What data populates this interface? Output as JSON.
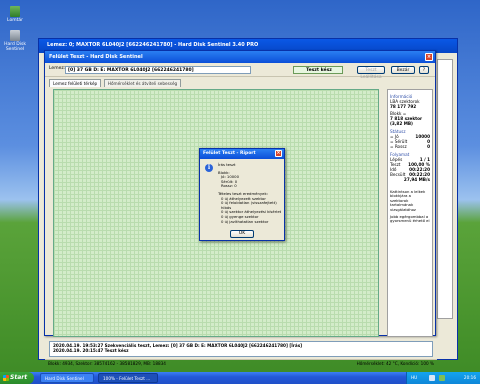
{
  "desktop": {
    "icons": [
      {
        "label": "Lomtár",
        "icon": "recycle-bin-icon"
      },
      {
        "label": "Hard Disk Sentinel",
        "icon": "hard-disk-icon"
      }
    ]
  },
  "bg_window": {
    "title": "Lemez: 0; MAXTOR 6L040J2 [662246241780] - Hard Disk Sentinel 3.40 PRO"
  },
  "main_window": {
    "title": "Felület Teszt - Hard Disk Sentinel",
    "disk_label": "Lemez:",
    "disk_value": "[0] 37 GB D: E: MAXTOR 6L040J2 [662246241780]",
    "status_field": "Teszt kész",
    "btn_stop": "Teszt Leállítása",
    "btn_close": "Bezár",
    "tabs": [
      "Lemez felületi térkép",
      "Hőmérséklet és átviteli sebesség"
    ],
    "right_panel": {
      "info_title": "Információ",
      "lba_label": "LBA szektorok",
      "lba_value": "78 177 792",
      "blocks_label": "Blokk =",
      "blocks_value": "7 818 szektor",
      "blocks_size": "(3,82 MB)",
      "status_title": "Státusz",
      "ok_label": "= Jó",
      "ok_value": "10000",
      "damaged_label": "= Sérült",
      "damaged_value": "0",
      "weak_label": "= Rossz",
      "weak_value": "0",
      "progress_title": "Folyamat",
      "step_label": "Lépés",
      "step_value": "1 / 1",
      "test_label": "Teszt",
      "test_value": "100,00 %",
      "time_label": "Idő",
      "time_value": "00:22:20",
      "est_label": "Becsült",
      "est_value": "00:22:20",
      "speed_value": "27,94 MB/s",
      "hint1": "Kattintson a lelkek blokkjára a szektorok tartalmának vizsgálatához",
      "hint2": "Jobb egérgombbal a gyorsmenü érhető el"
    },
    "log": [
      {
        "date": "2020.04.19.",
        "time": "19:53:27",
        "text": "Szekvenciális teszt, Lemez: [0] 37 GB D: E: MAXTOR 6L040J2 [662246241780] [Írás]"
      },
      {
        "date": "2020.04.19.",
        "time": "20:15:47",
        "text": "Teszt kész"
      }
    ],
    "status_left": "Blokk: 4934, Szektor: 38574162 - 38581829, MB: 18834",
    "status_right": "Hőmérséklet: 42 °C, Kondíció: 100 %"
  },
  "dialog": {
    "title": "Felület Teszt - Riport",
    "lines": [
      "Írás teszt",
      "",
      "Blokk:",
      "  Jó: 10000",
      "  Sérült: 0",
      "  Rossz: 0",
      "",
      "Tételes teszt eredmények:",
      "  0 új áthelyezett szektor",
      "  0 új feloldatlan (visszafejtett) hibás",
      "  0 új szektor áthelyezési kísérlet",
      "  0 új gyenge szektor",
      "  0 új javíthatatlan szektor"
    ],
    "ok": "OK"
  },
  "taskbar": {
    "start": "Start",
    "tasks": [
      "Hard Disk Sentinel",
      "100% - Felület Teszt ..."
    ],
    "lang": "HU",
    "clock": "20:16"
  },
  "colors": {
    "title_blue": "#0b4fd8",
    "grid_green": "#d3ecc9",
    "panel_blue": "#2f4fa8"
  }
}
